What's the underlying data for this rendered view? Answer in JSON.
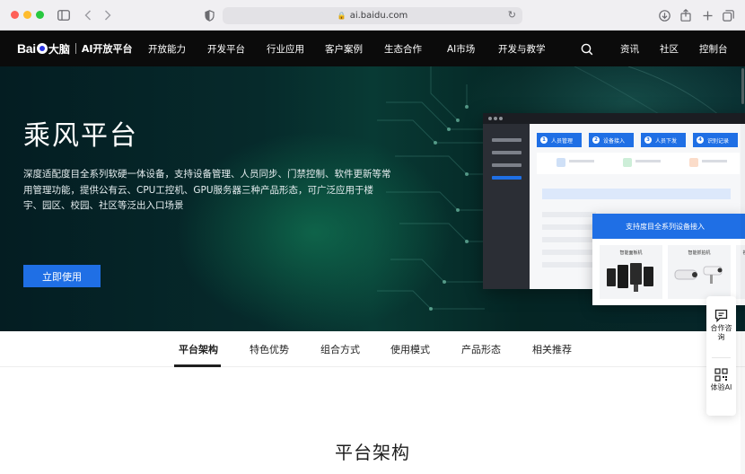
{
  "browser": {
    "url": "ai.baidu.com",
    "icons": [
      "sidebar-icon",
      "back-icon",
      "forward-icon",
      "shield-icon",
      "lock-icon",
      "reload-icon",
      "download-icon",
      "share-icon",
      "new-tab-icon",
      "tabs-overview-icon"
    ]
  },
  "site_nav": {
    "logo_text": "Bai",
    "logo_cn": "大脑",
    "logo_sub": "AI开放平台",
    "items": [
      "开放能力",
      "开发平台",
      "行业应用",
      "客户案例",
      "生态合作",
      "AI市场",
      "开发与教学"
    ],
    "right_items": [
      "资讯",
      "社区",
      "控制台"
    ]
  },
  "hero": {
    "title": "乘风平台",
    "description": "深度适配度目全系列软硬一体设备，支持设备管理、人员同步、门禁控制、软件更新等常用管理功能，提供公有云、CPU工控机、GPU服务器三种产品形态，可广泛应用于楼宇、园区、校园、社区等泛出入口场景",
    "cta": "立即使用"
  },
  "mockup": {
    "steps": [
      {
        "num": "1",
        "label": "人员管理"
      },
      {
        "num": "2",
        "label": "设备接入"
      },
      {
        "num": "3",
        "label": "人员下发"
      },
      {
        "num": "4",
        "label": "识别记录"
      }
    ],
    "device_card": {
      "title": "支持度目全系列设备接入",
      "tiles": [
        "智能面板机",
        "智能抓拍机",
        "视"
      ]
    }
  },
  "tabs": {
    "items": [
      "平台架构",
      "特色优势",
      "组合方式",
      "使用模式",
      "产品形态",
      "相关推荐"
    ],
    "active_index": 0
  },
  "section": {
    "title": "平台架构"
  },
  "float_widget": {
    "consult": "合作咨询",
    "try_ai": "体验AI"
  },
  "colors": {
    "accent": "#1f6fe5",
    "nav_bg": "#0b0b0b",
    "hero_bg": "#062a2b"
  }
}
